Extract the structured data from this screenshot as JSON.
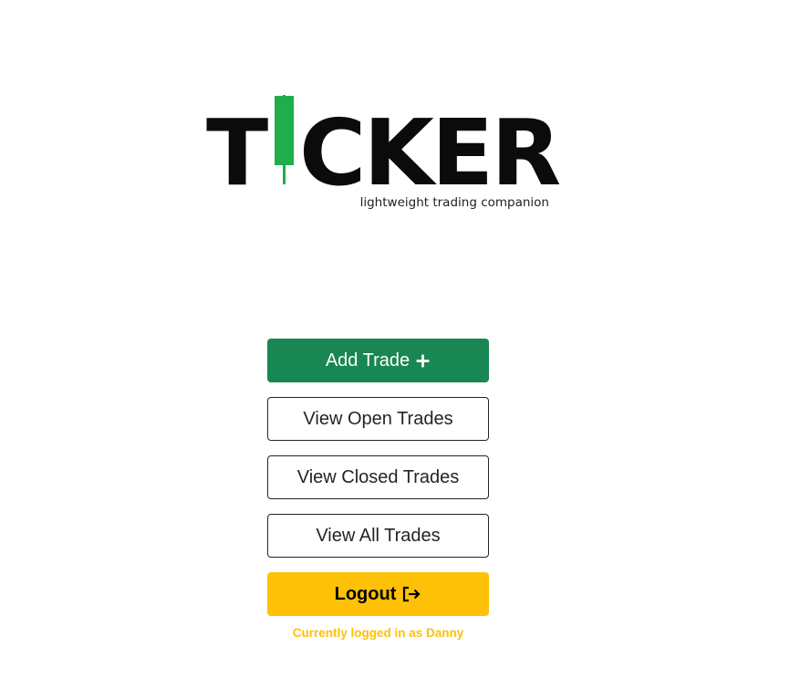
{
  "logo": {
    "letters_first": "T",
    "letters_rest": "CKER",
    "tagline": "lightweight trading companion",
    "candle_color": "#1fae4b",
    "icon": "candlestick-icon"
  },
  "menu": {
    "add_trade": {
      "label": "Add Trade",
      "icon": "plus-icon",
      "color": "#198754"
    },
    "view_open": {
      "label": "View Open Trades"
    },
    "view_closed": {
      "label": "View Closed Trades"
    },
    "view_all": {
      "label": "View All Trades"
    },
    "logout": {
      "label": "Logout",
      "icon": "logout-icon",
      "color": "#ffc107"
    }
  },
  "status": {
    "logged_in_text": "Currently logged in as Danny"
  }
}
